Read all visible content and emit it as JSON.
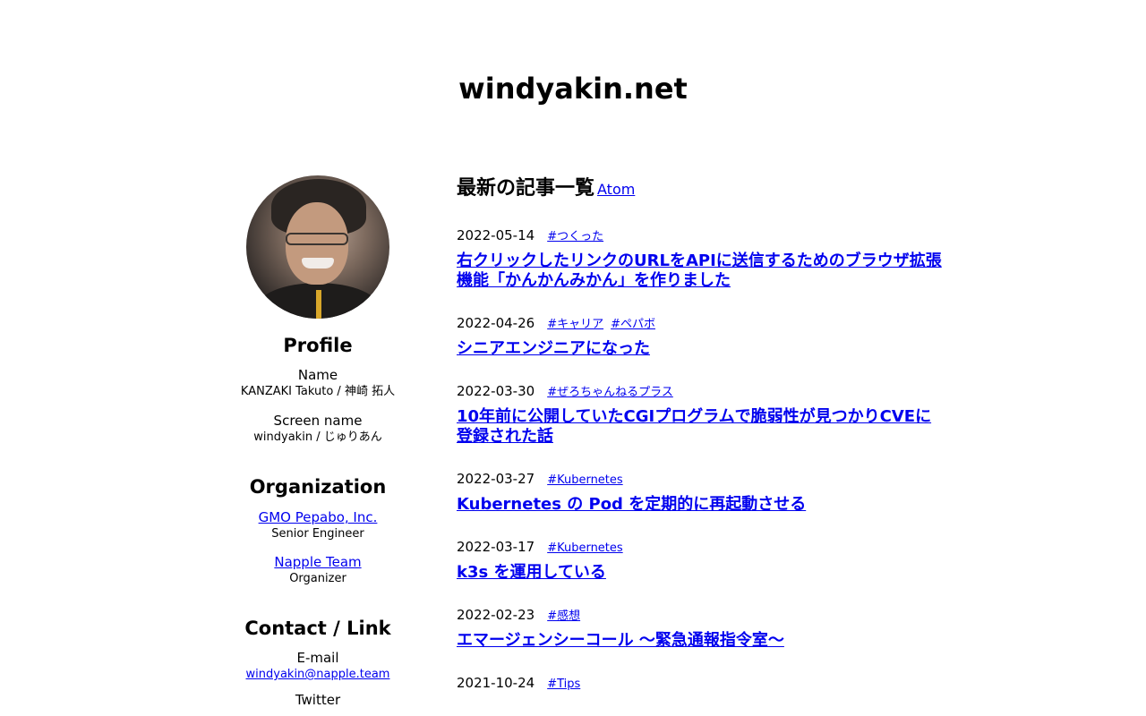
{
  "site": {
    "title": "windyakin.net"
  },
  "profile": {
    "heading": "Profile",
    "name_label": "Name",
    "name_value": "KANZAKI Takuto / 神崎 拓人",
    "screen_label": "Screen name",
    "screen_value": "windyakin / じゅりあん"
  },
  "organization": {
    "heading": "Organization",
    "items": [
      {
        "name": "GMO Pepabo, Inc.",
        "role": "Senior Engineer"
      },
      {
        "name": "Napple Team",
        "role": "Organizer"
      }
    ]
  },
  "contact": {
    "heading": "Contact / Link",
    "email_label": "E-mail",
    "email_value": "windyakin@napple.team",
    "twitter_label": "Twitter"
  },
  "articles": {
    "heading": "最新の記事一覧",
    "feed_label": "Atom",
    "items": [
      {
        "date": "2022-05-14",
        "tags": [
          "#つくった"
        ],
        "title": "右クリックしたリンクのURLをAPIに送信するためのブラウザ拡張機能「かんかんみかん」を作りました"
      },
      {
        "date": "2022-04-26",
        "tags": [
          "#キャリア",
          "#ペパボ"
        ],
        "title": "シニアエンジニアになった"
      },
      {
        "date": "2022-03-30",
        "tags": [
          "#ぜろちゃんねるプラス"
        ],
        "title": "10年前に公開していたCGIプログラムで脆弱性が見つかりCVEに登録された話"
      },
      {
        "date": "2022-03-27",
        "tags": [
          "#Kubernetes"
        ],
        "title": "Kubernetes の Pod を定期的に再起動させる"
      },
      {
        "date": "2022-03-17",
        "tags": [
          "#Kubernetes"
        ],
        "title": "k3s を運用している"
      },
      {
        "date": "2022-02-23",
        "tags": [
          "#感想"
        ],
        "title": "エマージェンシーコール 〜緊急通報指令室〜"
      },
      {
        "date": "2021-10-24",
        "tags": [
          "#Tips"
        ],
        "title": ""
      }
    ]
  }
}
